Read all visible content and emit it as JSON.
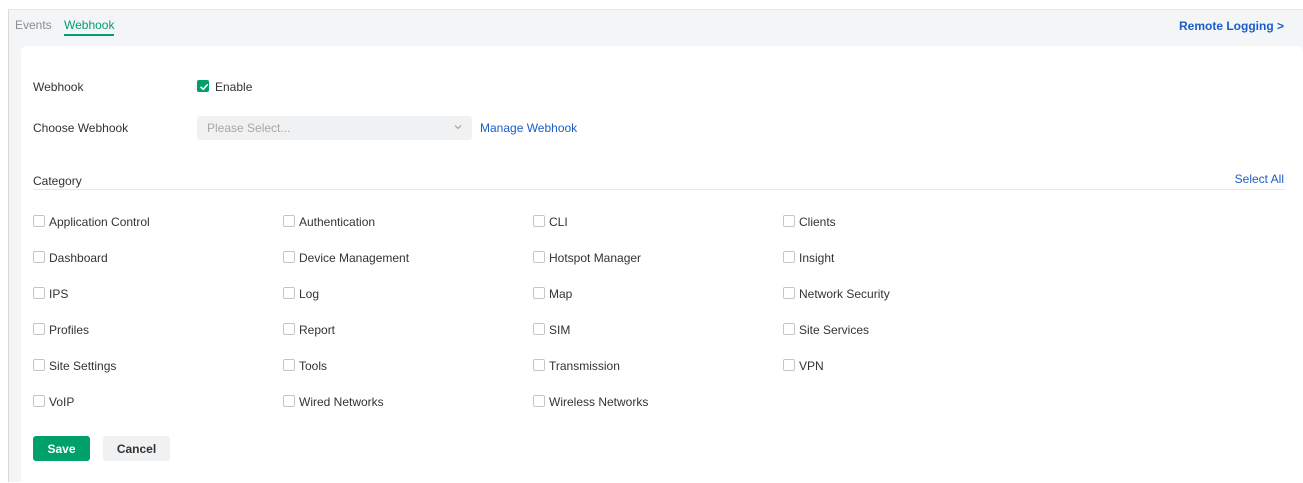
{
  "tabs": [
    {
      "label": "Events",
      "active": false
    },
    {
      "label": "Webhook",
      "active": true
    }
  ],
  "remote_logging_link": "Remote Logging >",
  "form": {
    "webhook_label": "Webhook",
    "enable_label": "Enable",
    "enable_checked": true,
    "choose_webhook_label": "Choose Webhook",
    "choose_webhook_placeholder": "Please Select...",
    "manage_webhook_link": "Manage Webhook",
    "category_label": "Category",
    "select_all_link": "Select All",
    "categories": [
      {
        "label": "Application Control",
        "checked": false
      },
      {
        "label": "Authentication",
        "checked": false
      },
      {
        "label": "CLI",
        "checked": false
      },
      {
        "label": "Clients",
        "checked": false
      },
      {
        "label": "Dashboard",
        "checked": false
      },
      {
        "label": "Device Management",
        "checked": false
      },
      {
        "label": "Hotspot Manager",
        "checked": false
      },
      {
        "label": "Insight",
        "checked": false
      },
      {
        "label": "IPS",
        "checked": false
      },
      {
        "label": "Log",
        "checked": false
      },
      {
        "label": "Map",
        "checked": false
      },
      {
        "label": "Network Security",
        "checked": false
      },
      {
        "label": "Profiles",
        "checked": false
      },
      {
        "label": "Report",
        "checked": false
      },
      {
        "label": "SIM",
        "checked": false
      },
      {
        "label": "Site Services",
        "checked": false
      },
      {
        "label": "Site Settings",
        "checked": false
      },
      {
        "label": "Tools",
        "checked": false
      },
      {
        "label": "Transmission",
        "checked": false
      },
      {
        "label": "VPN",
        "checked": false
      },
      {
        "label": "VoIP",
        "checked": false
      },
      {
        "label": "Wired Networks",
        "checked": false
      },
      {
        "label": "Wireless Networks",
        "checked": false
      }
    ]
  },
  "buttons": {
    "save": "Save",
    "cancel": "Cancel"
  },
  "colors": {
    "accent": "#00a06b",
    "link": "#1a5ec8"
  }
}
